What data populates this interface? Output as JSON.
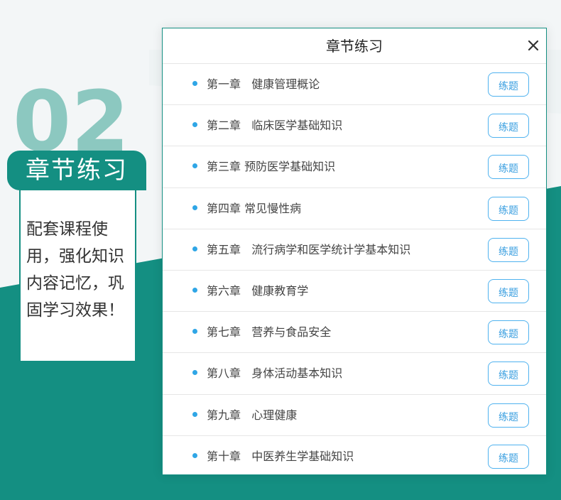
{
  "colors": {
    "teal": "#148f82",
    "teal_light": "#8cc8c0",
    "bullet_blue": "#2fa6e6",
    "button_blue": "#4fb2ef"
  },
  "promo": {
    "number": "02",
    "badge_text": "章节练习",
    "description": "配套课程使用，强化知识内容记忆，巩固学习效果！"
  },
  "modal": {
    "title": "章节练习",
    "close_icon": "close-icon",
    "chapters": [
      {
        "label": "第一章   健康管理概论",
        "button": "练题"
      },
      {
        "label": "第二章   临床医学基础知识",
        "button": "练题"
      },
      {
        "label": "第三章 预防医学基础知识",
        "button": "练题"
      },
      {
        "label": "第四章 常见慢性病",
        "button": "练题"
      },
      {
        "label": "第五章   流行病学和医学统计学基本知识",
        "button": "练题"
      },
      {
        "label": "第六章   健康教育学",
        "button": "练题"
      },
      {
        "label": "第七章   营养与食品安全",
        "button": "练题"
      },
      {
        "label": "第八章   身体活动基本知识",
        "button": "练题"
      },
      {
        "label": "第九章   心理健康",
        "button": "练题"
      },
      {
        "label": "第十章   中医养生学基础知识",
        "button": "练题"
      }
    ]
  }
}
